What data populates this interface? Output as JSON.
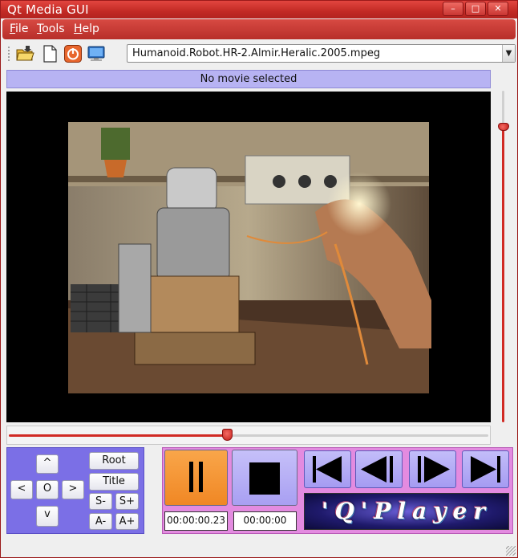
{
  "window": {
    "title": "Qt Media GUI",
    "controls": {
      "minimize": "–",
      "maximize": "□",
      "close": "✕"
    }
  },
  "menu": {
    "file": {
      "underline": "F",
      "rest": "ile"
    },
    "tools": {
      "underline": "T",
      "rest": "ools"
    },
    "help": {
      "underline": "H",
      "rest": "elp"
    }
  },
  "toolbar": {
    "icons": [
      "open-folder-icon",
      "new-file-icon",
      "power-icon",
      "monitor-icon"
    ],
    "file_select": {
      "value": "Humanoid.Robot.HR-2.Almir.Heralic.2005.mpeg",
      "arrow": "▼"
    }
  },
  "status": {
    "text": "No movie selected"
  },
  "video": {
    "description_icon": "video-frame"
  },
  "sliders": {
    "volume_fraction": 0.89,
    "seek_fraction": 0.455
  },
  "navigation": {
    "up": "^",
    "left": "<",
    "ok": "O",
    "right": ">",
    "down": "v",
    "root": "Root",
    "title": "Title",
    "s_minus": "S-",
    "s_plus": "S+",
    "a_minus": "A-",
    "a_plus": "A+"
  },
  "playback": {
    "elapsed": "00:00:00.23",
    "total": "00:00:00",
    "logo_text": "'Q'Player"
  },
  "colors": {
    "accent_red": "#c22a25",
    "status_lavender": "#b7b3f3",
    "nav_panel": "#7b6fe6",
    "ctrl_panel": "#e38be0",
    "pause_orange": "#f7932f"
  }
}
